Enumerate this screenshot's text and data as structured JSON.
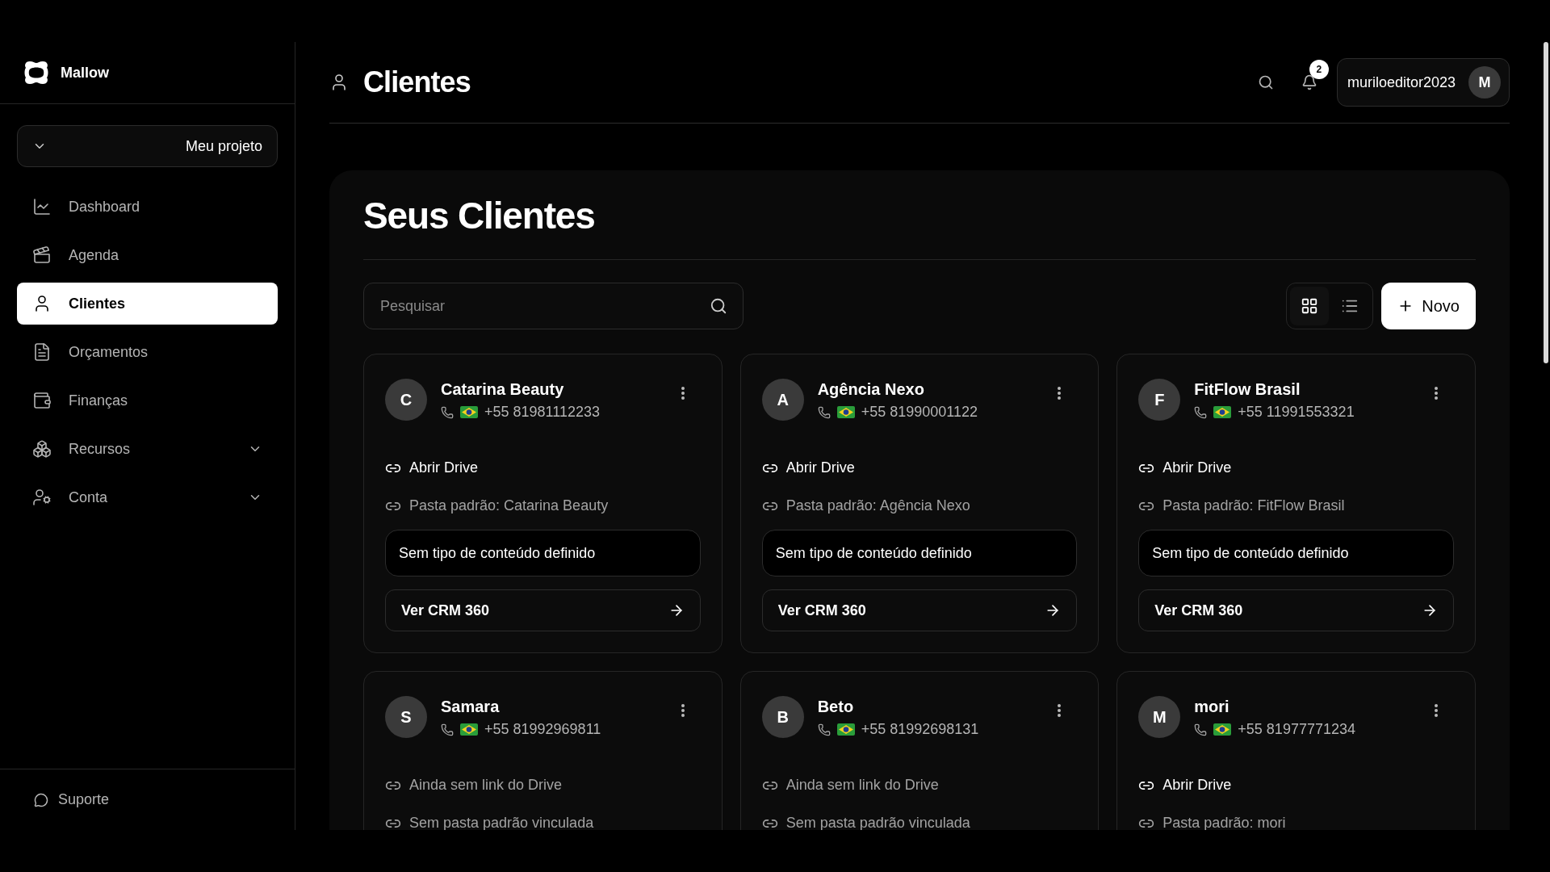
{
  "brand": {
    "name": "Mallow"
  },
  "project": {
    "label": "Meu projeto"
  },
  "nav": [
    {
      "label": "Dashboard",
      "selected": false
    },
    {
      "label": "Agenda",
      "selected": false
    },
    {
      "label": "Clientes",
      "selected": true
    },
    {
      "label": "Orçamentos",
      "selected": false
    },
    {
      "label": "Finanças",
      "selected": false
    },
    {
      "label": "Recursos",
      "selected": false,
      "expanded": false
    },
    {
      "label": "Conta",
      "selected": false,
      "expanded": false
    }
  ],
  "support": {
    "label": "Suporte"
  },
  "header": {
    "title": "Clientes",
    "notifications": "2",
    "user": "muriloeditor2023",
    "avatar": "M"
  },
  "panel": {
    "title": "Seus Clientes",
    "search": {
      "placeholder": "Pesquisar"
    },
    "views": [
      {
        "kind": "grid",
        "selected": true
      },
      {
        "kind": "list",
        "selected": false
      }
    ],
    "new_button": "Novo"
  },
  "clients": [
    {
      "initial": "C",
      "name": "Catarina Beauty",
      "phone": "+55 81981112233",
      "drive": {
        "label": "Abrir Drive",
        "linked": true
      },
      "folder": "Pasta padrão: Catarina Beauty",
      "content_type": "Sem tipo de conteúdo definido",
      "crm": "Ver CRM 360"
    },
    {
      "initial": "A",
      "name": "Agência Nexo",
      "phone": "+55 81990001122",
      "drive": {
        "label": "Abrir Drive",
        "linked": true
      },
      "folder": "Pasta padrão: Agência Nexo",
      "content_type": "Sem tipo de conteúdo definido",
      "crm": "Ver CRM 360"
    },
    {
      "initial": "F",
      "name": "FitFlow Brasil",
      "phone": "+55 11991553321",
      "drive": {
        "label": "Abrir Drive",
        "linked": true
      },
      "folder": "Pasta padrão: FitFlow Brasil",
      "content_type": "Sem tipo de conteúdo definido",
      "crm": "Ver CRM 360"
    },
    {
      "initial": "S",
      "name": "Samara",
      "phone": "+55 81992969811",
      "drive": {
        "label": "Ainda sem link do Drive",
        "linked": false
      },
      "folder": "Sem pasta padrão vinculada"
    },
    {
      "initial": "B",
      "name": "Beto",
      "phone": "+55 81992698131",
      "drive": {
        "label": "Ainda sem link do Drive",
        "linked": false
      },
      "folder": "Sem pasta padrão vinculada"
    },
    {
      "initial": "M",
      "name": "mori",
      "phone": "+55 81977771234",
      "drive": {
        "label": "Abrir Drive",
        "linked": true
      },
      "folder": "Pasta padrão: mori"
    }
  ]
}
